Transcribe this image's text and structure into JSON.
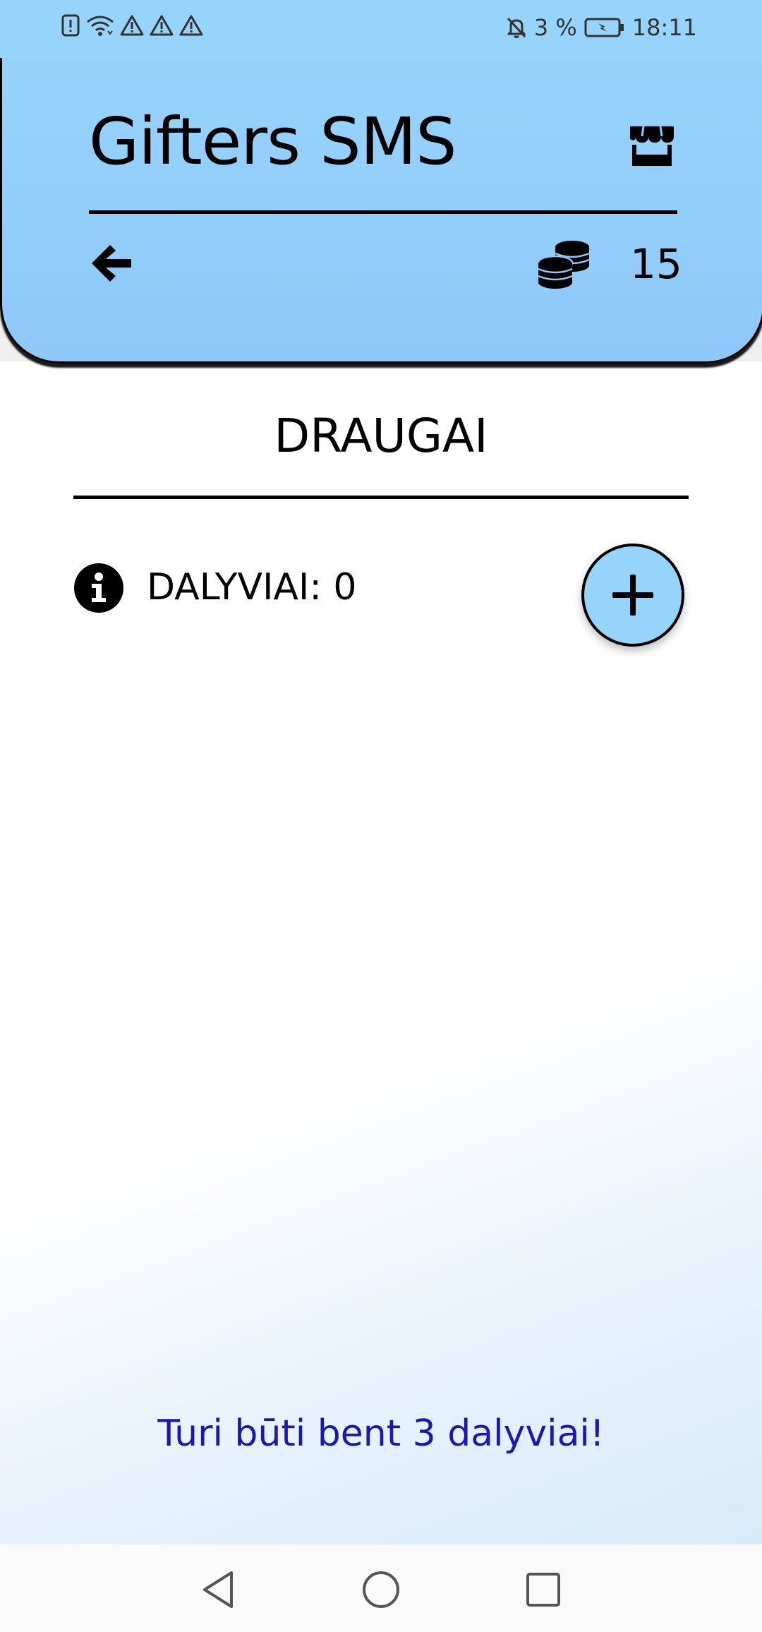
{
  "status_bar": {
    "left_icons": [
      "sim-alert-icon",
      "wifi-icon",
      "warning-icon",
      "warning-icon",
      "warning-icon"
    ],
    "mute_icon": "bell-off-icon",
    "battery_percent": "3 %",
    "battery_icon": "battery-charging-icon",
    "time": "18:11"
  },
  "header": {
    "title": "Gifters SMS",
    "shop_icon": "store-icon",
    "back_icon": "arrow-left-icon",
    "coins_icon": "coins-icon",
    "coin_count": "15"
  },
  "main": {
    "section_title": "DRAUGAI",
    "info_icon": "info-icon",
    "participants_label": "DALYVIAI: 0",
    "add_icon": "plus-icon",
    "warning_text": "Turi būti bent 3 dalyviai!"
  },
  "nav_bar": {
    "buttons": [
      "back-triangle-icon",
      "home-circle-icon",
      "recents-square-icon"
    ]
  },
  "colors": {
    "header_bg": "#97d4fb",
    "warning_text": "#1a17b5",
    "accent": "#000000"
  }
}
